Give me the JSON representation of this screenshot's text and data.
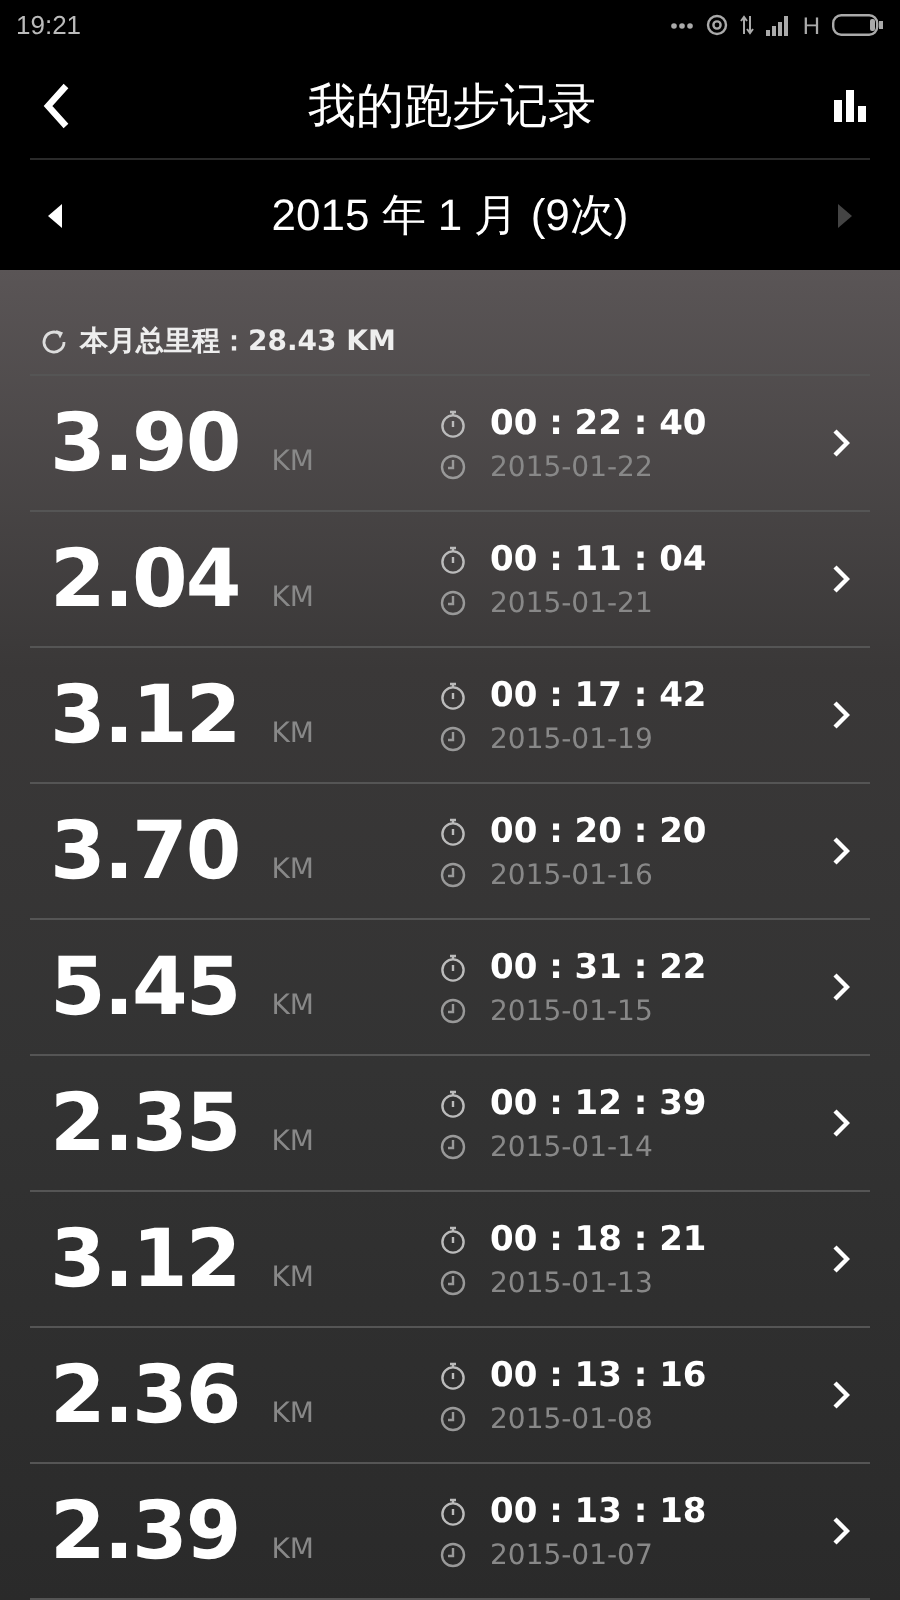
{
  "status_bar": {
    "time": "19:21",
    "network": "H"
  },
  "header": {
    "title": "我的跑步记录"
  },
  "month_nav": {
    "label": "2015 年 1 月 (9次)",
    "prev_disabled": false,
    "next_disabled": true
  },
  "summary": {
    "text": "本月总里程：28.43 KM"
  },
  "runs": [
    {
      "distance": "3.90",
      "unit": "KM",
      "duration": "00 : 22 : 40",
      "date": "2015-01-22"
    },
    {
      "distance": "2.04",
      "unit": "KM",
      "duration": "00 : 11 : 04",
      "date": "2015-01-21"
    },
    {
      "distance": "3.12",
      "unit": "KM",
      "duration": "00 : 17 : 42",
      "date": "2015-01-19"
    },
    {
      "distance": "3.70",
      "unit": "KM",
      "duration": "00 : 20 : 20",
      "date": "2015-01-16"
    },
    {
      "distance": "5.45",
      "unit": "KM",
      "duration": "00 : 31 : 22",
      "date": "2015-01-15"
    },
    {
      "distance": "2.35",
      "unit": "KM",
      "duration": "00 : 12 : 39",
      "date": "2015-01-14"
    },
    {
      "distance": "3.12",
      "unit": "KM",
      "duration": "00 : 18 : 21",
      "date": "2015-01-13"
    },
    {
      "distance": "2.36",
      "unit": "KM",
      "duration": "00 : 13 : 16",
      "date": "2015-01-08"
    },
    {
      "distance": "2.39",
      "unit": "KM",
      "duration": "00 : 13 : 18",
      "date": "2015-01-07"
    }
  ]
}
